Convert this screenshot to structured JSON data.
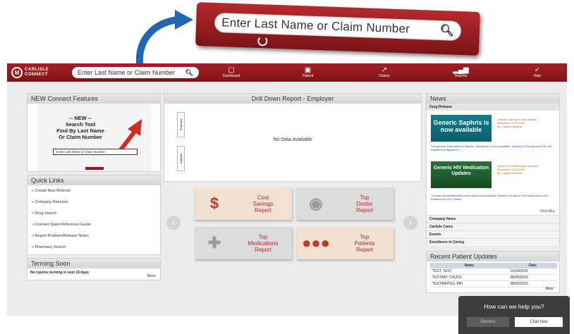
{
  "callout": {
    "search_placeholder": "Enter Last Name or Claim Number"
  },
  "navbar": {
    "logo_line1": "CARLISLE",
    "logo_line2": "CONNECT",
    "search_placeholder": "Enter Last Name or Claim Number",
    "items": [
      {
        "label": "Dashboard",
        "icon": "dashboard-icon"
      },
      {
        "label": "Patient",
        "icon": "patient-icon"
      },
      {
        "label": "Claims",
        "icon": "claims-icon"
      },
      {
        "label": "Reports",
        "icon": "reports-icon"
      },
      {
        "label": "Help",
        "icon": "help-icon"
      }
    ]
  },
  "features": {
    "title": "NEW Connect Features",
    "slide_text": "-- NEW --\nSearch Tool\nFind By Last Name\nOr Claim Number",
    "slide_search": "Enter Last Name or Claim Number"
  },
  "quick_links": {
    "title": "Quick Links",
    "items": [
      "» Create New Referral",
      "» Company Directory",
      "» Drug Search",
      "» Connect Quick Reference Guide",
      "» Report Problem/Release Notes",
      "» Pharmacy Search"
    ]
  },
  "terming": {
    "title": "Terming Soon",
    "empty_text": "No injuries terming in next 15 days",
    "more": "More"
  },
  "drill_down": {
    "title": "Drill Down Report - Employer",
    "tab_1": "Employer",
    "tab_2": "Adjuster",
    "empty": "No Data Available"
  },
  "reports": {
    "cost_savings": "Cost\nSavings\nReport",
    "top_doctor": "Top\nDoctor\nReport",
    "top_medications": "Top\nMedications\nReport",
    "top_patients": "Top\nPatients\nReport"
  },
  "news": {
    "title": "News",
    "section": "Drug Release",
    "item1": {
      "image_text": "Generic Saphris is now available",
      "meta": "Generic Saphris is Now Availab...\nReleased: 12/27/2020\nBy: Carlisle Medical",
      "desc": "The generic formulation of Saphris, asenapine, is now available. Saphris is FDA approved for the treatment of Bipolar Di..."
    },
    "item2": {
      "image_text": "Generic HIV Medication Updates",
      "meta": "Generic HIV Medication Updates\nReleased: 10/21/2020\nBy: Carlisle Medical",
      "desc": "Truvada (emtricitabine/tenofovir disoproxil fumarate) Gilead's Truvada is FDA approved for the treatment of HIV-1 infect..."
    },
    "view_all": "View All ▸",
    "categories": [
      "Company News",
      "Carlisle Cares",
      "Events",
      "Excellence in Caring"
    ]
  },
  "patients": {
    "title": "Recent Patient Updates",
    "columns": [
      "Name",
      "Date"
    ],
    "rows": [
      [
        "TEST, TEST",
        "11/14/2019"
      ],
      [
        "TESTPAT, CHUCK",
        "08/05/2019"
      ],
      [
        "TESTWAITES, PAT",
        "08/02/2019"
      ]
    ],
    "more": "More"
  },
  "chat": {
    "question": "How can we help you?",
    "dismiss": "Dismiss",
    "chat_now": "Chat now"
  }
}
